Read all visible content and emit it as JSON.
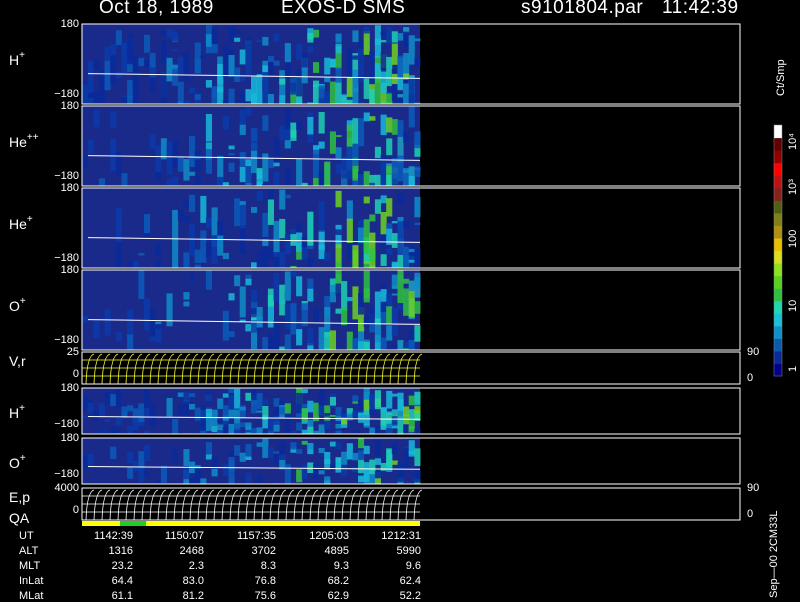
{
  "header": {
    "date": "Oct 18, 1989",
    "instrument": "EXOS-D SMS",
    "file": "s9101804.par",
    "time": "11:42:39"
  },
  "colors": {
    "background": "#000000",
    "panel_fill": "#1a2a8a",
    "trace": "#ffffff",
    "vr_lines": "#ffff33",
    "qa_good": "#ffff00",
    "qa_alt": "#22cc22"
  },
  "chart_data": [
    {
      "type": "heatmap",
      "label": "H",
      "sup": "+",
      "yticks": [
        "180",
        "−180"
      ],
      "ylim": [
        -180,
        180
      ],
      "note": "time-pitch angle spectrogram; active data span ends near 1213 UT; intensity rises (cyan/green) toward later times"
    },
    {
      "type": "heatmap",
      "label": "He",
      "sup": "++",
      "yticks": [
        "180",
        "−180"
      ],
      "ylim": [
        -180,
        180
      ]
    },
    {
      "type": "heatmap",
      "label": "He",
      "sup": "+",
      "yticks": [
        "180",
        "−180"
      ],
      "ylim": [
        -180,
        180
      ]
    },
    {
      "type": "heatmap",
      "label": "O",
      "sup": "+",
      "yticks": [
        "180",
        "−180"
      ],
      "ylim": [
        -180,
        180
      ]
    },
    {
      "type": "line",
      "label": "V,r",
      "yticks": [
        "25",
        "0"
      ],
      "y2ticks": [
        "90",
        "0"
      ]
    },
    {
      "type": "heatmap",
      "label": "H",
      "sup": "+",
      "yticks": [
        "180",
        "−180"
      ],
      "ylim": [
        -180,
        180
      ]
    },
    {
      "type": "heatmap",
      "label": "O",
      "sup": "+",
      "yticks": [
        "180",
        "−180"
      ],
      "ylim": [
        -180,
        180
      ]
    },
    {
      "type": "line",
      "label": "E,p",
      "label2": "QA",
      "yticks": [
        "4000",
        "0"
      ],
      "y2ticks": [
        "90",
        "0"
      ]
    }
  ],
  "colorbar": {
    "units": "Ct/Smp",
    "ticks": [
      "10⁴",
      "10³",
      "100",
      "10",
      "1"
    ],
    "colors": [
      "#000088",
      "#0a2a99",
      "#0a5ab0",
      "#1090c8",
      "#18c0d8",
      "#20d8b0",
      "#30c040",
      "#58d020",
      "#90e020",
      "#d8e020",
      "#e8c000",
      "#b09010",
      "#808018",
      "#506010",
      "#882020",
      "#c01010",
      "#ff0000",
      "#900000",
      "#600000",
      "#ffffff"
    ]
  },
  "footer": {
    "rows": [
      {
        "name": "UT",
        "values": [
          "1142:39",
          "1150:07",
          "1157:35",
          "1205:03",
          "1212:31"
        ]
      },
      {
        "name": "ALT",
        "values": [
          "1316",
          "2468",
          "3702",
          "4895",
          "5990"
        ]
      },
      {
        "name": "MLT",
        "values": [
          "23.2",
          "2.3",
          "8.3",
          "9.3",
          "9.6"
        ]
      },
      {
        "name": "InLat",
        "values": [
          "64.4",
          "83.0",
          "76.8",
          "68.2",
          "62.4"
        ]
      },
      {
        "name": "MLat",
        "values": [
          "61.1",
          "81.2",
          "75.6",
          "62.9",
          "52.2"
        ]
      }
    ],
    "side_text": "Sep—00  2CM33L"
  }
}
